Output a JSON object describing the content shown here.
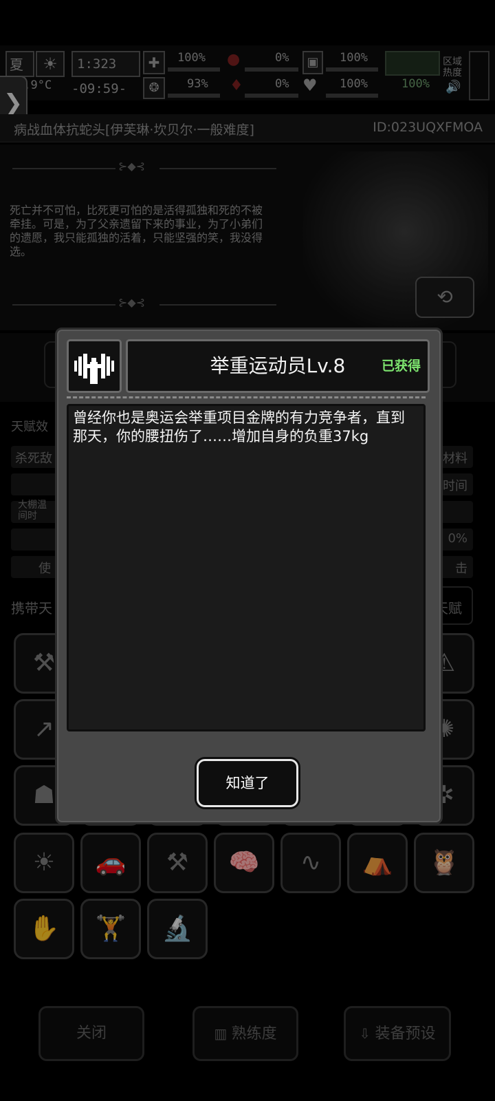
{
  "status": {
    "season": "夏",
    "temperature": "3.9°C",
    "day": "1:323",
    "time": "-09:59-",
    "health": "100%",
    "stamina": "93%",
    "bleeding": "0%",
    "blood_loss": "0%",
    "stomach": "100%",
    "heart": "100%",
    "water": "100%",
    "region": "区域",
    "heat": "热度"
  },
  "header": {
    "title": "病战血体抗蛇头[伊芙琳·坎贝尔·一般难度]",
    "id": "ID:023UQXFMOA"
  },
  "story": {
    "quote": "死亡并不可怕，比死更可怕的是活得孤独和死的不被牵挂。可是，为了父亲遗留下来的事业，为了小弟们的遗愿，我只能孤独的活着，只能坚强的笑，我没得选。"
  },
  "background": {
    "talent_effects": "天赋效",
    "row1_left": "杀死敌",
    "row1_right": "材料",
    "row2_right": "时间",
    "row3_left": "大棚温\n间时",
    "row4_right": "0%",
    "row5_left": "使",
    "row5_right": "击",
    "carry_label": "携带天",
    "talent_btn": "天赋"
  },
  "grid_icons": [
    [
      "⚒",
      "",
      "",
      "",
      "",
      "",
      "⚠"
    ],
    [
      "↗",
      "",
      "",
      "",
      "",
      "",
      "✺"
    ],
    [
      "☗",
      "",
      "",
      "",
      "",
      "",
      "✲"
    ],
    [
      "☀",
      "🚗",
      "⚒",
      "🧠",
      "∿",
      "⛺",
      "🦉"
    ],
    [
      "✋",
      "🏋",
      "🔬"
    ]
  ],
  "bottom": {
    "close": "关闭",
    "proficiency": "熟练度",
    "preset": "装备预设"
  },
  "modal": {
    "name": "举重运动员Lv.8",
    "status": "已获得",
    "description": "曾经你也是奥运会举重项目金牌的有力竞争者，直到那天，你的腰扭伤了……增加自身的负重37kg",
    "ok_button": "知道了",
    "icon": "dumbbell-icon"
  },
  "colors": {
    "obtained": "#7de46f",
    "modal_bg": "#474747",
    "text_box_bg": "#1b1b1b"
  }
}
